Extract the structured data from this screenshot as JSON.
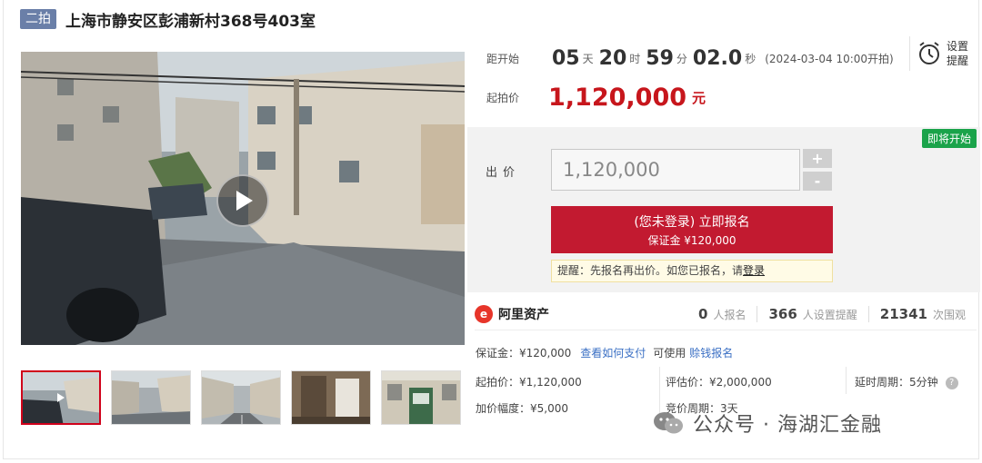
{
  "title": {
    "round_tag": "二拍",
    "text": "上海市静安区彭浦新村368号403室"
  },
  "countdown": {
    "label": "距开始",
    "days": "05",
    "days_unit": "天",
    "hours": "20",
    "hours_unit": "时",
    "minutes": "59",
    "minutes_unit": "分",
    "seconds": "02.0",
    "seconds_unit": "秒",
    "start_time": "(2024-03-04 10:00开拍)"
  },
  "reminder": {
    "line1": "设置",
    "line2": "提醒"
  },
  "start_price": {
    "label": "起拍价",
    "value": "1,120,000",
    "unit": "元"
  },
  "bid": {
    "status_badge": "即将开始",
    "label": "出价",
    "input_value": "1,120,000",
    "plus": "+",
    "minus": "-",
    "signup_main": "(您未登录) 立即报名",
    "signup_sub": "保证金 ¥120,000",
    "tip_text": "提醒：先报名再出价。如您已报名，请",
    "tip_link": "登录"
  },
  "brand": {
    "logo": "e",
    "name": "阿里资产"
  },
  "stats": [
    {
      "num": "0",
      "unit": "人报名"
    },
    {
      "num": "366",
      "unit": "人设置提醒"
    },
    {
      "num": "21341",
      "unit": "次围观"
    }
  ],
  "details": {
    "deposit": "保证金：¥120,000",
    "how_to_pay": "查看如何支付",
    "usable": "可使用",
    "credit_signup": "赊钱报名",
    "start_price": "起拍价：¥1,120,000",
    "appraisal": "评估价：¥2,000,000",
    "delay": "延时周期：5分钟",
    "help": "?",
    "increment": "加价幅度：¥5,000",
    "auction_period": "竞价周期：3天"
  },
  "watermark": "公众号 · 海湖汇金融",
  "colors": {
    "accent_red": "#c21a30",
    "price_red": "#c7161c",
    "green_badge": "#1aa34a",
    "tag_blue": "#6a7fa8"
  }
}
